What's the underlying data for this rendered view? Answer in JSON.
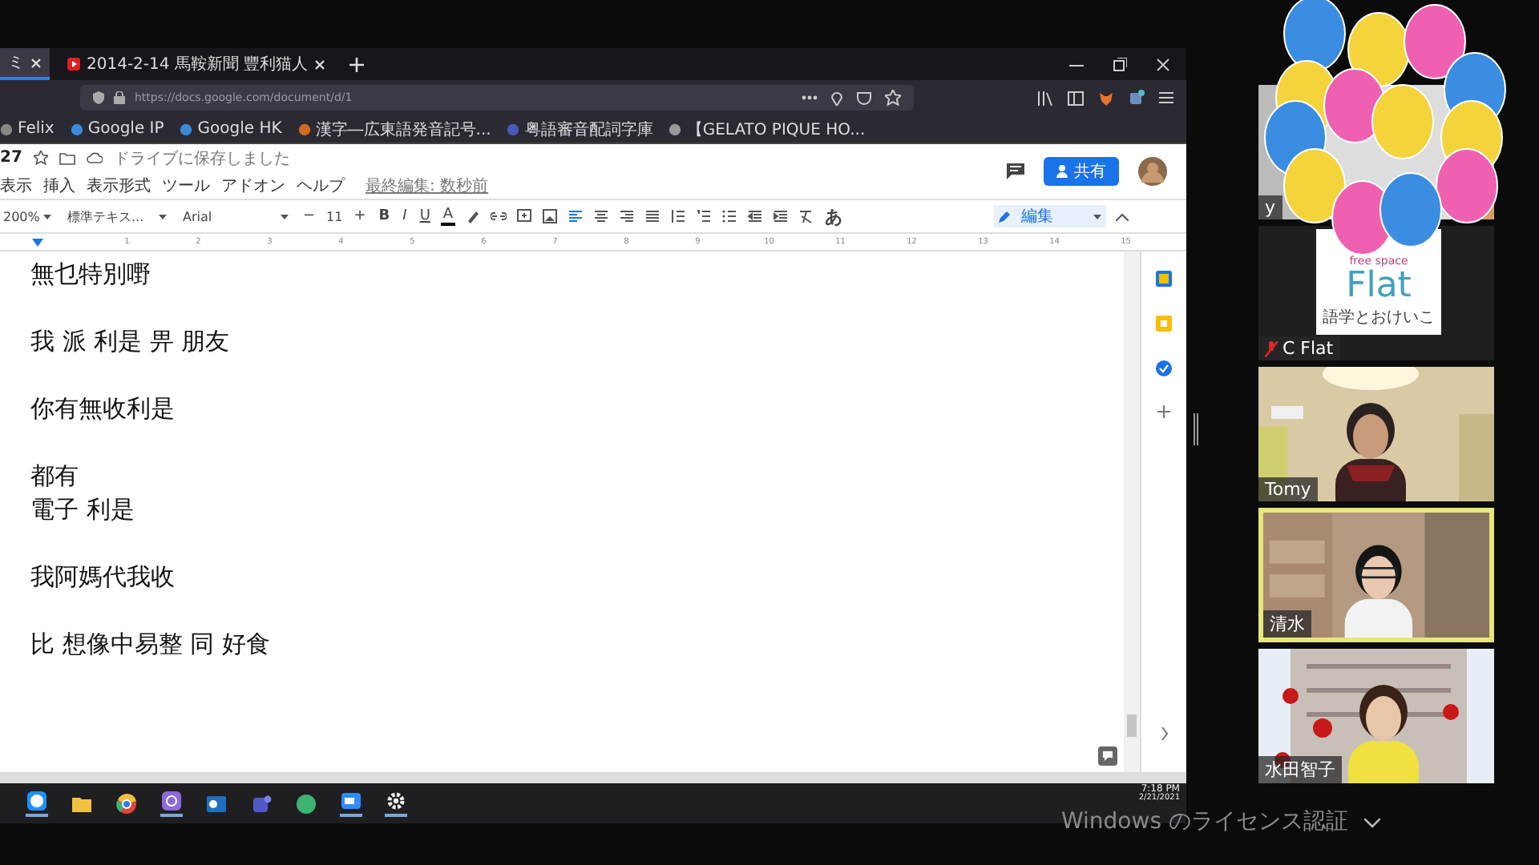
{
  "browser": {
    "tabs": [
      {
        "label": "ミ",
        "selected": true
      },
      {
        "label": "2014-2-14 馬鞍新聞 豐利猫人",
        "selected": false
      }
    ],
    "url": "https://docs.google.com/document/d/1",
    "bookmarks": [
      "Felix",
      "Google IP",
      "Google HK",
      "漢字―広東語発音記号...",
      "粤語審音配詞字庫",
      "【GELATO PIQUE HO..."
    ]
  },
  "docs": {
    "title": "27",
    "save_status": "ドライブに保存しました",
    "menus": [
      "表示",
      "挿入",
      "表示形式",
      "ツール",
      "アドオン",
      "ヘルプ"
    ],
    "last_edit": "最終編集: 数秒前",
    "share": "共有",
    "toolbar": {
      "zoom": "200%",
      "style": "標準テキス...",
      "font": "Arial",
      "minus": "−",
      "size": "11",
      "plus": "+",
      "format": [
        "B",
        "I",
        "U",
        "A"
      ],
      "input_tool": "あ",
      "mode": "編集"
    },
    "ruler": [
      "1",
      "2",
      "3",
      "4",
      "5",
      "6",
      "7",
      "8",
      "9",
      "10",
      "11",
      "12",
      "13",
      "14",
      "15"
    ],
    "paragraphs": [
      [
        "無乜特別嘢"
      ],
      [
        "我 派 利是 畀 朋友"
      ],
      [
        "你有無收利是"
      ],
      [
        "都有",
        "電子 利是"
      ],
      [
        "我阿媽代我收"
      ],
      [
        "比 想像中易整 同 好食"
      ]
    ]
  },
  "taskbar": {
    "time": "7:18 PM",
    "date": "2/21/2021"
  },
  "participants": [
    {
      "name": "y",
      "kind": "video",
      "speaking": false,
      "muted": false
    },
    {
      "name": "C Flat",
      "kind": "logo",
      "speaking": false,
      "muted": true,
      "logo": [
        "free space",
        "Flat",
        "語学とおけいこ"
      ]
    },
    {
      "name": "Tomy",
      "kind": "video",
      "speaking": false,
      "muted": false
    },
    {
      "name": "清水",
      "kind": "video",
      "speaking": true,
      "muted": false
    },
    {
      "name": "水田智子",
      "kind": "video",
      "speaking": false,
      "muted": false
    }
  ],
  "activation": "Windows のライセンス認証"
}
